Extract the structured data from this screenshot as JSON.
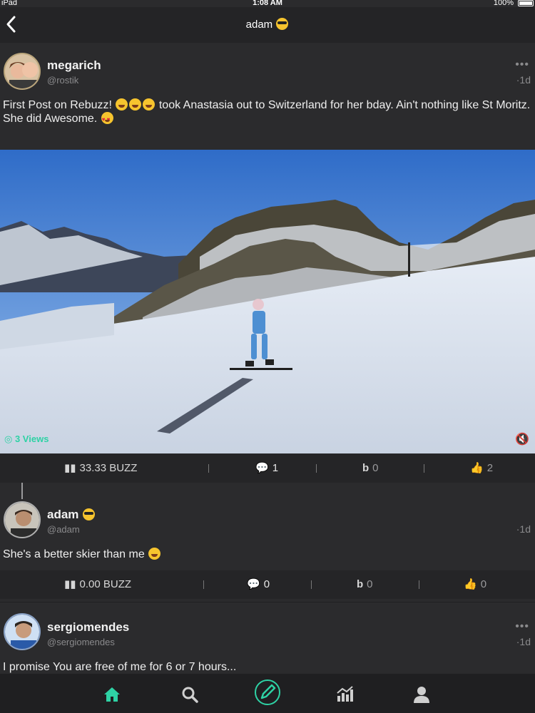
{
  "status_bar": {
    "device": "iPad",
    "time": "1:08 AM",
    "battery": "100%"
  },
  "nav": {
    "title": "adam"
  },
  "main_post": {
    "username": "megarich",
    "handle": "@rostik",
    "time": "·1d",
    "more": "•••",
    "text_a": "First Post on Rebuzz!",
    "text_b": " took Anastasia out to Switzerland for her bday. Ain't nothing like St Moritz. She did Awesome.",
    "views": "3 Views",
    "stats": {
      "buzz": "33.33 BUZZ",
      "comments": "1",
      "rebuzz": "0",
      "likes": "2"
    }
  },
  "reply_post": {
    "username": "adam",
    "handle": "@adam",
    "time": "·1d",
    "text": "She's a better skier than me",
    "stats": {
      "buzz": "0.00 BUZZ",
      "comments": "0",
      "rebuzz": "0",
      "likes": "0"
    }
  },
  "third_post": {
    "username": "sergiomendes",
    "handle": "@sergiomendes",
    "time": "·1d",
    "more": "•••",
    "text": "I promise You are free of me for 6 or 7 hours..."
  },
  "colors": {
    "accent": "#2ed2a5",
    "background": "#2b2b2d",
    "bar": "#252527"
  },
  "tabs": [
    "home-icon",
    "search-icon",
    "compose-icon",
    "stats-icon",
    "profile-icon"
  ]
}
